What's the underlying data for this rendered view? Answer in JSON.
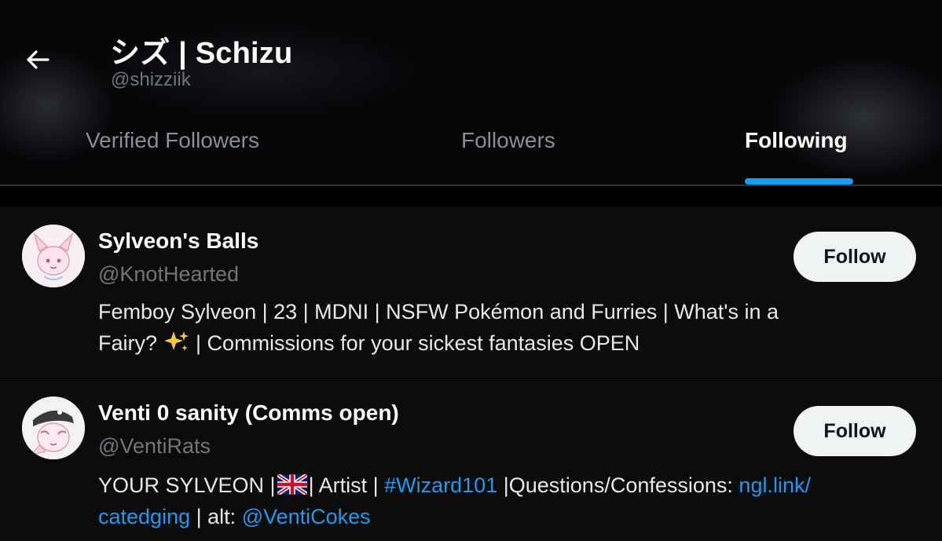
{
  "header": {
    "back_icon": "arrow-left-icon",
    "title": "シズ | Schizu",
    "handle": "@shizziik"
  },
  "tabs": [
    {
      "label": "Verified Followers",
      "active": false
    },
    {
      "label": "Followers",
      "active": false
    },
    {
      "label": "Following",
      "active": true
    }
  ],
  "accent_color": "#1d9bf0",
  "users": [
    {
      "name": "Sylveon's Balls",
      "handle": "@KnotHearted",
      "button_label": "Follow",
      "bio_line1": "Femboy Sylveon | 23 | MDNI | NSFW Pokémon and Furries | What's in a",
      "bio_line2_a": "Fairy?",
      "bio_emoji": "sparkles-icon",
      "bio_line2_b": "| Commissions for your sickest fantasies OPEN"
    },
    {
      "name": "Venti 0 sanity (Comms open)",
      "handle": "@VentiRats",
      "button_label": "Follow",
      "bio_a": "YOUR SYLVEON |",
      "bio_flag": "uk-flag-icon",
      "bio_b": "| Artist |",
      "bio_hashtag": "#Wizard101",
      "bio_c": "|Questions/Confessions:",
      "bio_link1": "ngl.link/",
      "bio_link1_cont": "catedging",
      "bio_d": "| alt:",
      "bio_mention": "@VentiCokes"
    }
  ]
}
